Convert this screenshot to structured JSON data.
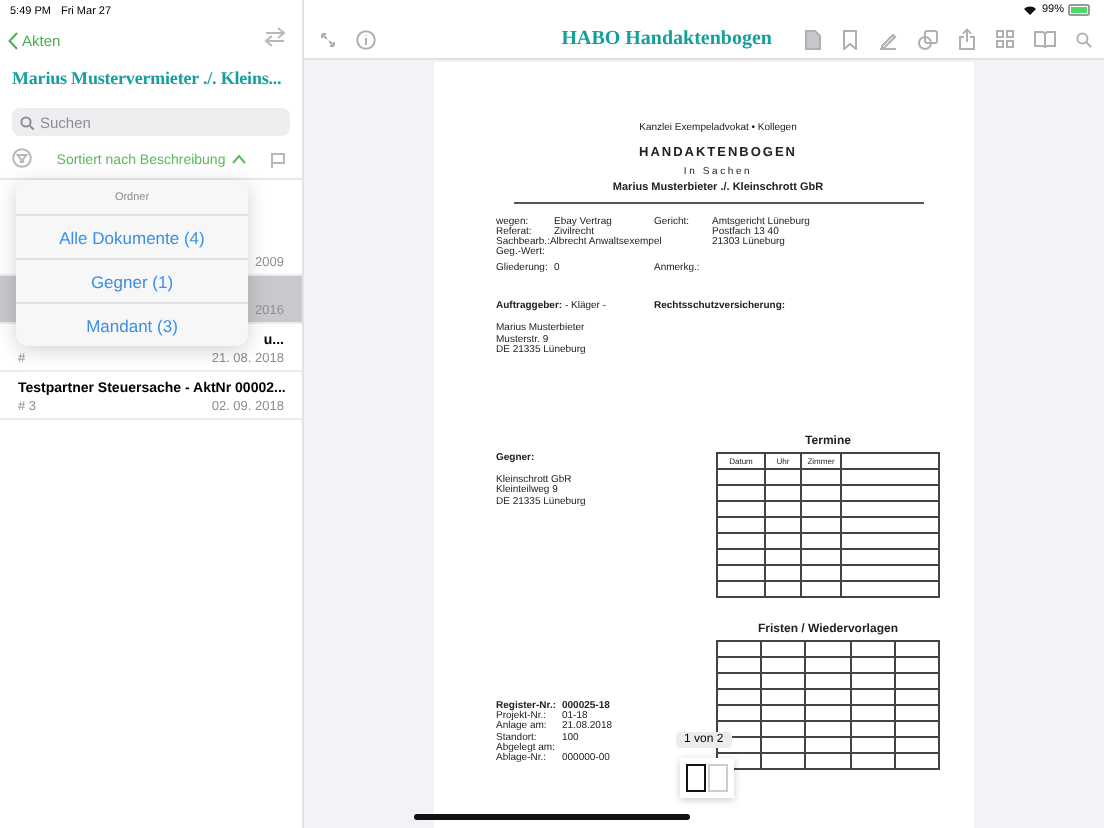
{
  "status_bar": {
    "time": "5:49 PM",
    "date": "Fri Mar 27",
    "battery": "99%"
  },
  "sidebar": {
    "back_label": "Akten",
    "title": "Marius Mustervermieter ./. Kleins...",
    "search": {
      "placeholder": "Suchen"
    },
    "sort_label": "Sortiert nach Beschreibung",
    "rows": [
      {
        "kind": "covered",
        "date": "2009",
        "selected": false
      },
      {
        "kind": "covered",
        "date": "2016",
        "selected": true
      },
      {
        "kind": "covered",
        "title": "u...",
        "number": "#",
        "date": "21. 08. 2018",
        "selected": false
      },
      {
        "kind": "full",
        "title": "Testpartner Steuersache - AktNr 00002...",
        "number": "# 3",
        "date": "02. 09. 2018",
        "selected": false
      }
    ],
    "popover": {
      "header": "Ordner",
      "items": [
        "Alle Dokumente (4)",
        "Gegner (1)",
        "Mandant (3)"
      ]
    }
  },
  "toolbar": {
    "title": "HABO Handaktenbogen"
  },
  "document": {
    "firm": "Kanzlei Exempeladvokat • Kollegen",
    "heading": "HANDAKTENBOGEN",
    "subheading": "In Sachen",
    "parties": "Marius Musterbieter ./. Kleinschrott GbR",
    "fields_left": [
      {
        "label": "wegen:",
        "value": "Ebay Vertrag"
      },
      {
        "label": "Referat:",
        "value": "Zivilrecht"
      },
      {
        "label": "Sachbearb.:",
        "value": "Albrecht Anwaltsexempel"
      },
      {
        "label": "Geg.-Wert:"
      },
      {
        "label": "Gliederung:",
        "value": "0"
      }
    ],
    "fields_right": [
      {
        "label": "Gericht:",
        "value": "Amtsgericht Lüneburg"
      },
      {
        "value": "Postfach 13 40"
      },
      {
        "value": "21303 Lüneburg"
      },
      {
        "label": "Anmerkg.:"
      }
    ],
    "client": "**Auftraggeber:** - Kläger -",
    "insurance": "Rechtsschutzversicherung:",
    "client_address": [
      "Marius Musterbieter",
      "Musterstr. 9",
      "DE 21335 Lüneburg"
    ],
    "opponent": {
      "label": "Gegner:",
      "lines": [
        "Kleinschrott GbR",
        "Kleinteilweg 9",
        "DE 21335 Lüneburg"
      ]
    },
    "appointments": {
      "title": "Termine",
      "columns": [
        "Datum",
        "Uhr",
        "Zimmer"
      ]
    },
    "deadlines": {
      "title": "Fristen / Wiedervorlagen"
    },
    "register": [
      {
        "label": "Register-Nr.:",
        "value": "000025-18"
      },
      {
        "label": "Projekt-Nr.:",
        "value": "01-18"
      },
      {
        "label": "Anlage am:",
        "value": "21.08.2018"
      },
      {
        "label": "Standort:",
        "value": "100"
      },
      {
        "label": "Abgelegt am:"
      },
      {
        "label": "Ablage-Nr.:",
        "value": "000000-00"
      }
    ]
  },
  "page_indicator": "1 von 2",
  "thumbnails": [
    {
      "selected": true
    },
    {
      "selected": false
    }
  ]
}
